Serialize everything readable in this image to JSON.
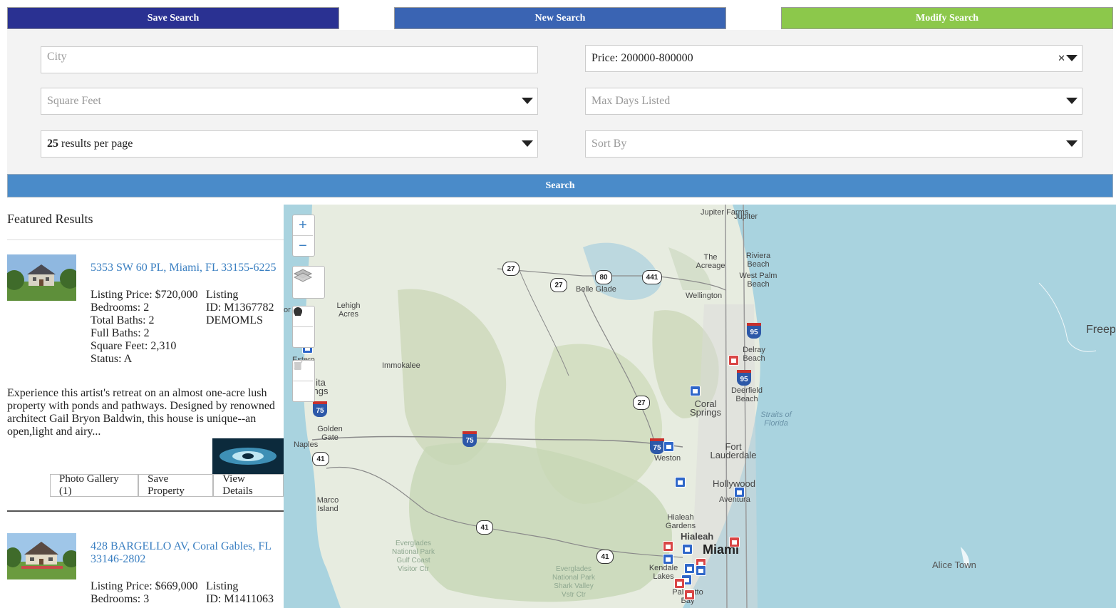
{
  "toolbar": {
    "save_search": "Save Search",
    "new_search": "New Search",
    "modify_search": "Modify Search"
  },
  "filters": {
    "city_placeholder": "City",
    "price_value": "Price: 200000-800000",
    "square_feet_placeholder": "Square Feet",
    "max_days_placeholder": "Max Days Listed",
    "per_page_count": "25",
    "per_page_suffix": " results per page",
    "sort_by_placeholder": "Sort By",
    "search_button": "Search"
  },
  "results": {
    "heading": "Featured Results",
    "listings": [
      {
        "address": "5353 SW 60 PL, Miami, FL 33155-6225",
        "price": "Listing Price: $720,000",
        "bedrooms": "Bedrooms: 2",
        "total_baths": "Total Baths: 2",
        "full_baths": "Full Baths: 2",
        "square_feet": "Square Feet: 2,310",
        "status": "Status: A",
        "listing_label": "Listing",
        "listing_id": "ID: M1367782",
        "source": "DEMOMLS",
        "description": "Experience this artist's retreat on an almost one-acre lush property with ponds and pathways. Designed by renowned architect Gail Bryon Baldwin, this house is unique--an open,light and airy...",
        "photo_gallery": "Photo Gallery (1)",
        "save_property": "Save Property",
        "view_details": "View Details"
      },
      {
        "address": "428 BARGELLO AV, Coral Gables, FL 33146-2802",
        "price": "Listing Price: $669,000",
        "bedrooms": "Bedrooms: 3",
        "listing_label": "Listing",
        "listing_id": "ID: M1411063"
      }
    ]
  },
  "map": {
    "zoom_in": "+",
    "zoom_out": "−",
    "labels": {
      "jupiter_farms": "Jupiter Farms",
      "jupiter": "Jupiter",
      "the_acreage": "The Acreage",
      "riviera_beach": "Riviera Beach",
      "west_palm_beach": "West Palm Beach",
      "wellington": "Wellington",
      "belle_glade": "Belle Glade",
      "lehigh_acres": "Lehigh Acres",
      "immokalee": "Immokalee",
      "delray_beach": "Delray Beach",
      "deerfield_beach": "Deerfield Beach",
      "coral_springs": "Coral Springs",
      "fort_lauderdale": "Fort Lauderdale",
      "weston": "Weston",
      "hollywood": "Hollywood",
      "aventura": "Aventura",
      "hialeah_gardens": "Hialeah Gardens",
      "hialeah": "Hialeah",
      "miami": "Miami",
      "kendale_lakes": "Kendale Lakes",
      "palmetto": "Palmetto Bay",
      "golden_gate": "Golden Gate",
      "naples": "Naples",
      "marco_island": "Marco Island",
      "bonita_springs": "ita ngs",
      "estero": "Estero",
      "fort_myers": "or",
      "straits": "Straits of Florida",
      "everglades_gulf": "Everglades National Park Gulf Coast Visitor Ctr",
      "everglades_shark": "Everglades National Park Shark Valley Vstr Ctr",
      "freeport": "Freep",
      "alice_town": "Alice Town"
    },
    "highway_shields": [
      "27",
      "27",
      "80",
      "441",
      "95",
      "95",
      "27",
      "75",
      "75",
      "75",
      "41",
      "41",
      "41"
    ]
  },
  "colors": {
    "save_search": "#2a3192",
    "new_search": "#3a64b3",
    "modify_search": "#8cc84b",
    "search_bar": "#4a8bc9",
    "link": "#3a7fc1"
  }
}
